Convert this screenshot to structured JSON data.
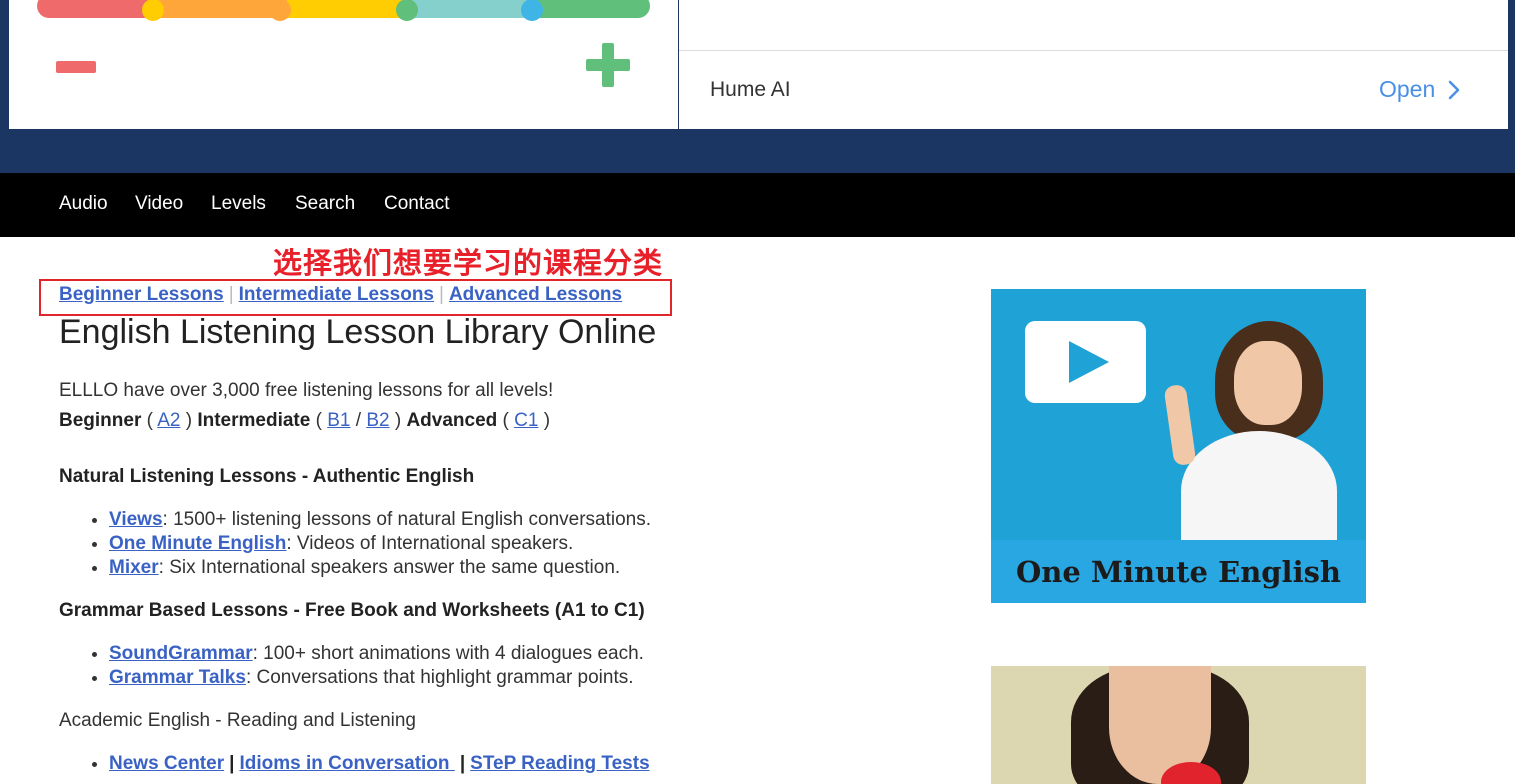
{
  "ad": {
    "advertiser": "Hume AI",
    "open_label": "Open",
    "rating_colors": [
      "#ef6b6b",
      "#ffa63b",
      "#ffcd02",
      "#85d0cc",
      "#5fbf7b"
    ],
    "minus_color": "#ef6b6b",
    "plus_color": "#5fbf7b"
  },
  "nav": {
    "items": [
      "Audio",
      "Video",
      "Levels",
      "Search",
      "Contact"
    ]
  },
  "annotation": {
    "text": "选择我们想要学习的课程分类"
  },
  "level_links": [
    "Beginner Lessons",
    "Intermediate Lessons",
    "Advanced Lessons"
  ],
  "page": {
    "title": "English Listening Lesson Library Online",
    "intro": "ELLLO have over 3,000 free listening lessons for all levels!",
    "levels": {
      "beginner_label": "Beginner",
      "beginner_links": [
        "A2"
      ],
      "intermediate_label": "Intermediate",
      "intermediate_links": [
        "B1",
        "B2"
      ],
      "advanced_label": "Advanced",
      "advanced_links": [
        "C1"
      ]
    }
  },
  "sections": [
    {
      "title": "Natural Listening Lessons - Authentic English",
      "items": [
        {
          "link": "Views",
          "desc": ": 1500+ listening lessons of natural English conversations."
        },
        {
          "link": "One Minute English",
          "desc": ": Videos of International speakers."
        },
        {
          "link": "Mixer",
          "desc": ": Six International speakers answer the same question."
        }
      ]
    },
    {
      "title": "Grammar Based Lessons - Free Book and Worksheets (A1 to C1)",
      "items": [
        {
          "link": "SoundGrammar",
          "desc": ": 100+ short animations with 4 dialogues each."
        },
        {
          "link": "Grammar Talks",
          "desc": ": Conversations that highlight grammar points."
        }
      ]
    },
    {
      "title": "Academic English - Reading and Listening",
      "links": [
        "News Center",
        "Idioms in Conversation ",
        "STeP Reading Tests"
      ]
    }
  ],
  "promos": {
    "one_minute_english_caption": "One Minute English"
  },
  "colors": {
    "link": "#3a62c5",
    "nav_bg": "#000000",
    "band_bg": "#1c3663",
    "annotation": "#e8202a"
  }
}
